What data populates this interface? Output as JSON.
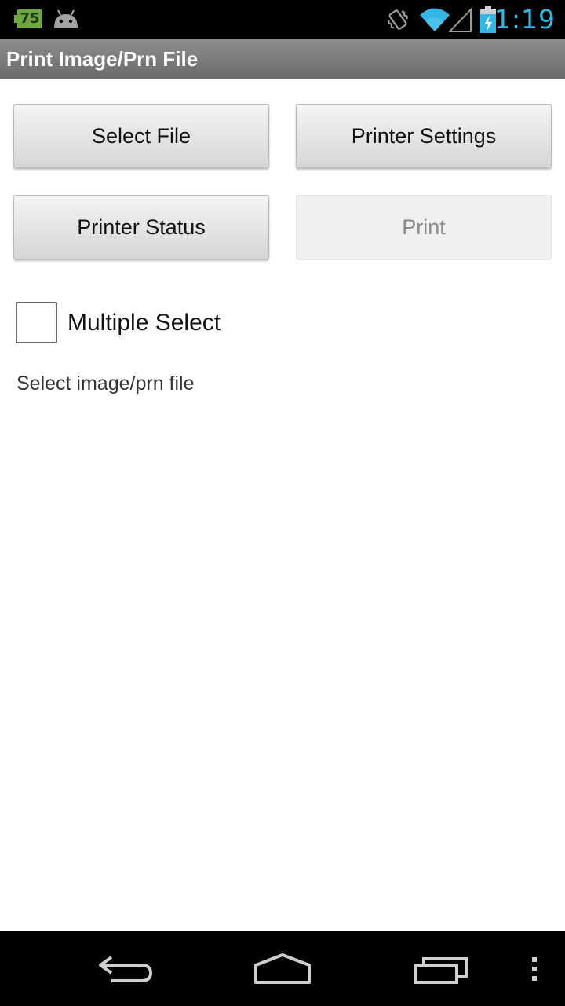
{
  "status_bar": {
    "notification_badge": "75",
    "time": "1:19",
    "accent_color": "#33b5e5",
    "icons": [
      "battery-notification-icon",
      "android-icon",
      "vibrate-icon",
      "wifi-icon",
      "signal-icon",
      "battery-charging-icon"
    ]
  },
  "action_bar": {
    "title": "Print Image/Prn File"
  },
  "buttons": {
    "select_file": "Select File",
    "printer_settings": "Printer Settings",
    "printer_status": "Printer Status",
    "print": "Print"
  },
  "multiple_select": {
    "label": "Multiple Select",
    "checked": false
  },
  "hint": "Select image/prn file",
  "nav_bar": {
    "icons": [
      "back-icon",
      "home-icon",
      "recent-apps-icon",
      "overflow-menu-icon"
    ]
  }
}
